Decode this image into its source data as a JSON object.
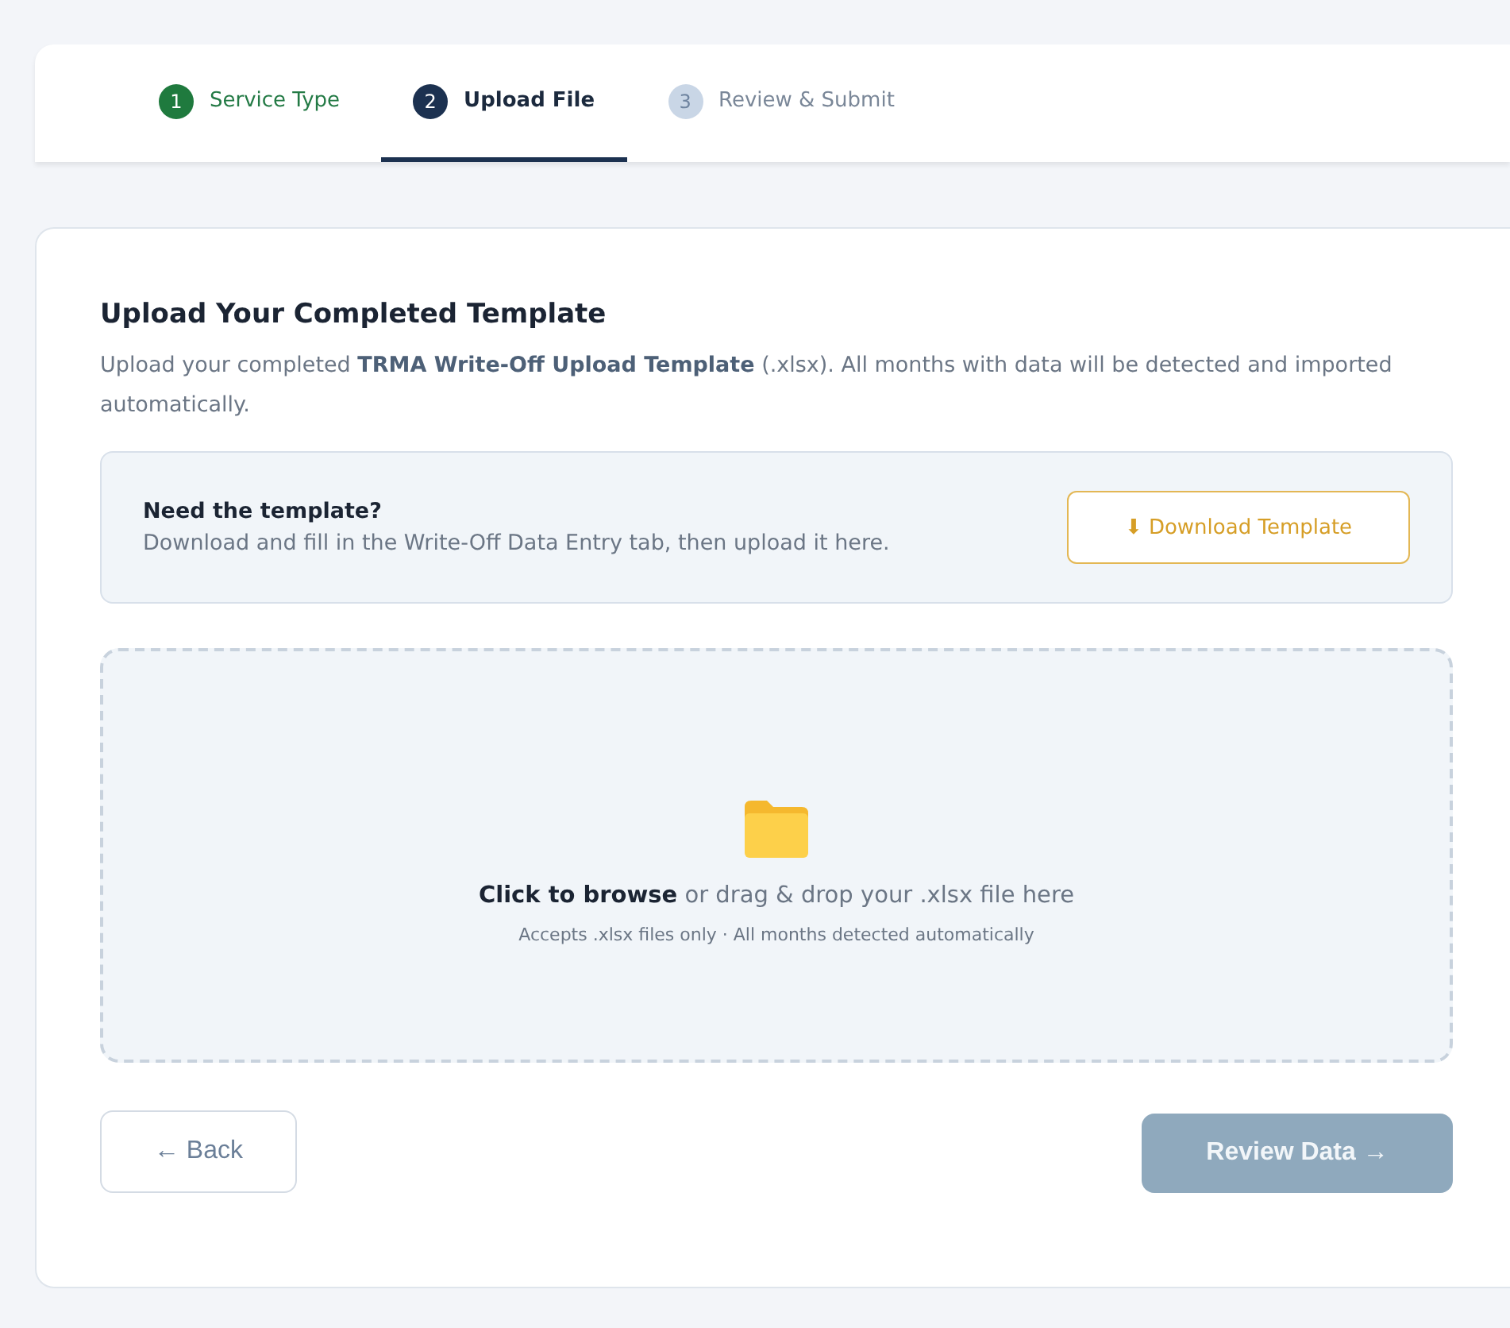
{
  "steps": [
    {
      "number": "1",
      "label": "Service Type",
      "done": true,
      "selected": false
    },
    {
      "number": "2",
      "label": "Upload File",
      "done": false,
      "selected": true
    },
    {
      "number": "3",
      "label": "Review & Submit",
      "done": false,
      "selected": false
    }
  ],
  "upload": {
    "title": "Upload Your Completed Template",
    "description": "Upload your completed **TRMA Write-Off Upload Template** (.xlsx). All months with data will be detected and imported automatically.",
    "template_box": {
      "title": "Need the template?",
      "text": "Download and fill in the Write-Off Data Entry tab, then upload it here.",
      "button": "⬇ Download Template"
    },
    "dropzone": {
      "prompt": "**Click to browse** or drag & drop your .xlsx file here",
      "hint": "Accepts .xlsx files only · All months detected automatically"
    }
  },
  "buttons": [
    {
      "label": "← Back",
      "kind": "back",
      "disabled": false
    },
    {
      "label": "Review Data →",
      "kind": "next",
      "disabled": true
    }
  ]
}
